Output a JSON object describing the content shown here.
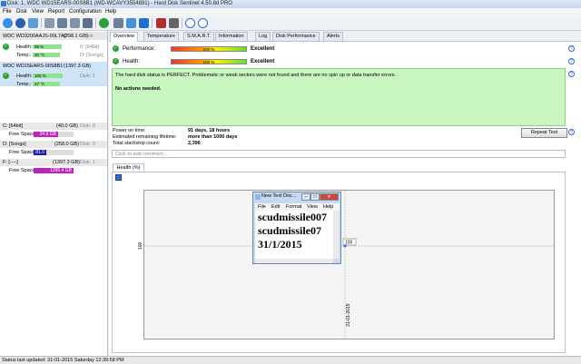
{
  "window": {
    "title": "Disk: 1, WDC WD15EARS-00S8B1 (WD-WCAVY3554891)  -  Hard Disk Sentinel 4.50.8d PRO"
  },
  "menu": [
    "File",
    "Disk",
    "View",
    "Report",
    "Configuration",
    "Help"
  ],
  "disks": [
    {
      "name": "WDC WD3200AAJS-00L7A0",
      "capacity": "(298.1 GB)",
      "disk_no": "Disk",
      "health": "99 %",
      "health_frac": 0.99,
      "health_extra": "0: [64bit]",
      "temp": "30 °C",
      "temp_extra": "D: [Songs]",
      "selected": false
    },
    {
      "name": "WDC WD15EARS-00S8B1",
      "capacity": "(1397.3 GB)",
      "disk_no": "",
      "health": "100 %",
      "health_frac": 1.0,
      "health_extra": "Disk: 1",
      "temp": "27 °C",
      "temp_extra": "",
      "selected": true
    }
  ],
  "labels": {
    "health": "Health:",
    "temp": "Temp.:",
    "free_space": "Free Space"
  },
  "volumes": [
    {
      "name": "C: [64bit]",
      "size": "(40.0 GB)",
      "disk": "Disk: 0",
      "free": "24.9 GB",
      "free_frac": 0.62,
      "color": "#c020c0"
    },
    {
      "name": "D: [Songs]",
      "size": "(258.0 GB)",
      "disk": "Disk: 0",
      "free": "81.0 GB",
      "free_frac": 0.31,
      "color": "#1a1aa8"
    },
    {
      "name": "F: [----]",
      "size": "(1397.3 GB)",
      "disk": "Disk: 1",
      "free": "1395.4 GB",
      "free_frac": 0.99,
      "color": "#c020c0"
    }
  ],
  "tabs": [
    "Overview",
    "Temperature",
    "S.M.A.R.T.",
    "Information",
    "Log",
    "Disk Performance",
    "Alerts"
  ],
  "overview": {
    "performance_label": "Performance:",
    "performance_value": "100 %",
    "performance_frac": 1.0,
    "performance_rating": "Excellent",
    "health_label": "Health:",
    "health_value": "100 %",
    "health_frac": 1.0,
    "health_rating": "Excellent",
    "status_text": "The hard disk status is PERFECT. Problematic or weak sectors were not found and there are no spin up or data transfer errors.",
    "actions_text": "No actions needed.",
    "power_on_label": "Power on time:",
    "power_on_value": "91 days, 18 hours",
    "remaining_label": "Estimated remaining lifetime:",
    "remaining_value": "more than 1000 days",
    "startstop_label": "Total start/stop count:",
    "startstop_value": "2,396",
    "repeat_button": "Repeat Test",
    "comment_placeholder": "Click to add comment ...",
    "health_tab": "Health (%)"
  },
  "chart_data": {
    "type": "line",
    "x": [
      "31-01-2015"
    ],
    "series": [
      {
        "values": [
          100
        ]
      }
    ],
    "y_tick": "100",
    "point_label": "100"
  },
  "notepad": {
    "title": "New Text Doc...",
    "menu": [
      "File",
      "Edit",
      "Format",
      "View",
      "Help"
    ],
    "lines": [
      "scudmissile007",
      "scudmissile07",
      "31/1/2015"
    ]
  },
  "statusbar": {
    "text": "Status last updated: 31-01-2015 Saturday 12:39:58 PM"
  }
}
